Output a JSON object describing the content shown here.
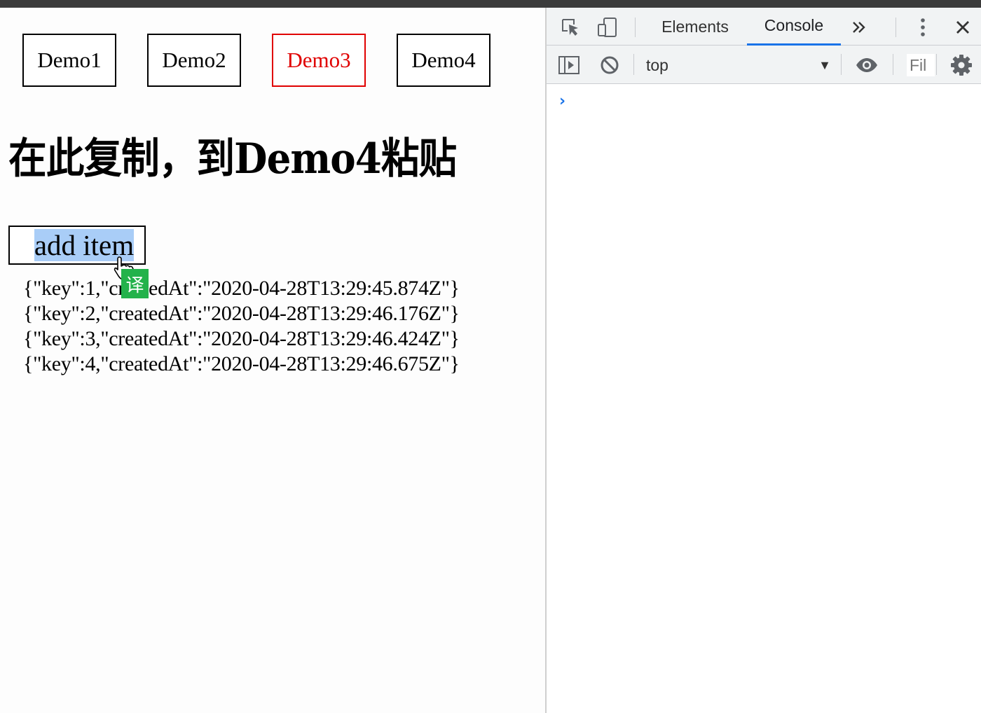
{
  "page": {
    "demo_buttons": [
      {
        "label": "Demo1",
        "active": false
      },
      {
        "label": "Demo2",
        "active": false
      },
      {
        "label": "Demo3",
        "active": true
      },
      {
        "label": "Demo4",
        "active": false
      }
    ],
    "heading": "在此复制，到Demo4粘贴",
    "add_item_label": "add item",
    "translate_badge": "译",
    "items": [
      "{\"key\":1,\"createdAt\":\"2020-04-28T13:29:45.874Z\"}",
      "{\"key\":2,\"createdAt\":\"2020-04-28T13:29:46.176Z\"}",
      "{\"key\":3,\"createdAt\":\"2020-04-28T13:29:46.424Z\"}",
      "{\"key\":4,\"createdAt\":\"2020-04-28T13:29:46.675Z\"}"
    ],
    "active_color": "#e00000",
    "selection_color": "#a9cdf7",
    "translate_color": "#23b24b"
  },
  "devtools": {
    "tabs": [
      {
        "label": "Elements",
        "active": false
      },
      {
        "label": "Console",
        "active": true
      }
    ],
    "more_tabs_icon": "chevron-double-right-icon",
    "context": "top",
    "filter_placeholder": "Fil",
    "prompt_symbol": "›",
    "accent_color": "#1a73e8"
  }
}
